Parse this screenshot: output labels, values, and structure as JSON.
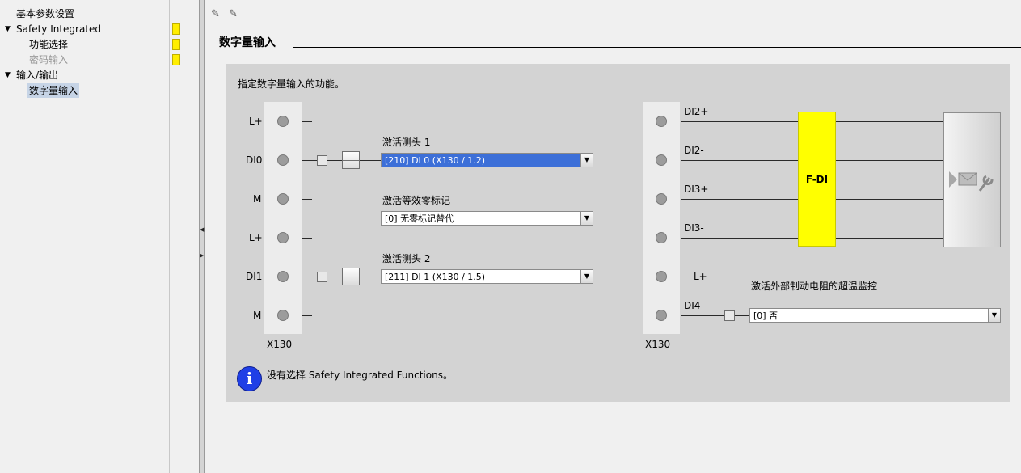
{
  "tree": {
    "items": [
      {
        "label": "基本参数设置",
        "arrow": "",
        "status": false,
        "state": "normal"
      },
      {
        "label": "Safety Integrated",
        "arrow": "▼",
        "status": true,
        "state": "normal"
      },
      {
        "label": "功能选择",
        "arrow": "",
        "status": true,
        "state": "normal"
      },
      {
        "label": "密码输入",
        "arrow": "",
        "status": true,
        "state": "disabled"
      },
      {
        "label": "输入/输出",
        "arrow": "▼",
        "status": false,
        "state": "normal"
      },
      {
        "label": "数字量输入",
        "arrow": "",
        "status": false,
        "state": "selected"
      }
    ]
  },
  "toolbar": {
    "icon1": "edit-pencil-icon",
    "icon2": "edit-pencil-icon"
  },
  "section": {
    "title": "数字量输入"
  },
  "panel": {
    "description": "指定数字量输入的功能。",
    "left_strip": {
      "connector": "X130",
      "pins": [
        "L+",
        "DI0",
        "M",
        "L+",
        "DI1",
        "M"
      ]
    },
    "probe1": {
      "label": "激活测头 1",
      "value": "[210] DI 0 (X130 / 1.2)"
    },
    "zero_mark": {
      "label": "激活等效零标记",
      "value": "[0] 无零标记替代"
    },
    "probe2": {
      "label": "激活测头 2",
      "value": "[211] DI 1 (X130 / 1.5)"
    },
    "right_strip": {
      "connector": "X130",
      "pins": [
        "DI2+",
        "DI2-",
        "DI3+",
        "DI3-",
        "L+",
        "DI4"
      ]
    },
    "fdi_label": "F-DI",
    "overtemp": {
      "label": "激活外部制动电阻的超温监控",
      "value": "[0] 否"
    },
    "info": {
      "text": "没有选择 Safety Integrated Functions。",
      "icon": "info-icon"
    }
  },
  "colors": {
    "status_yellow": "#ffee00",
    "fdi_yellow": "#ffff00",
    "selected_blue": "#3c6fd8",
    "panel_gray": "#d3d3d3",
    "info_blue": "#1f3fe6"
  }
}
